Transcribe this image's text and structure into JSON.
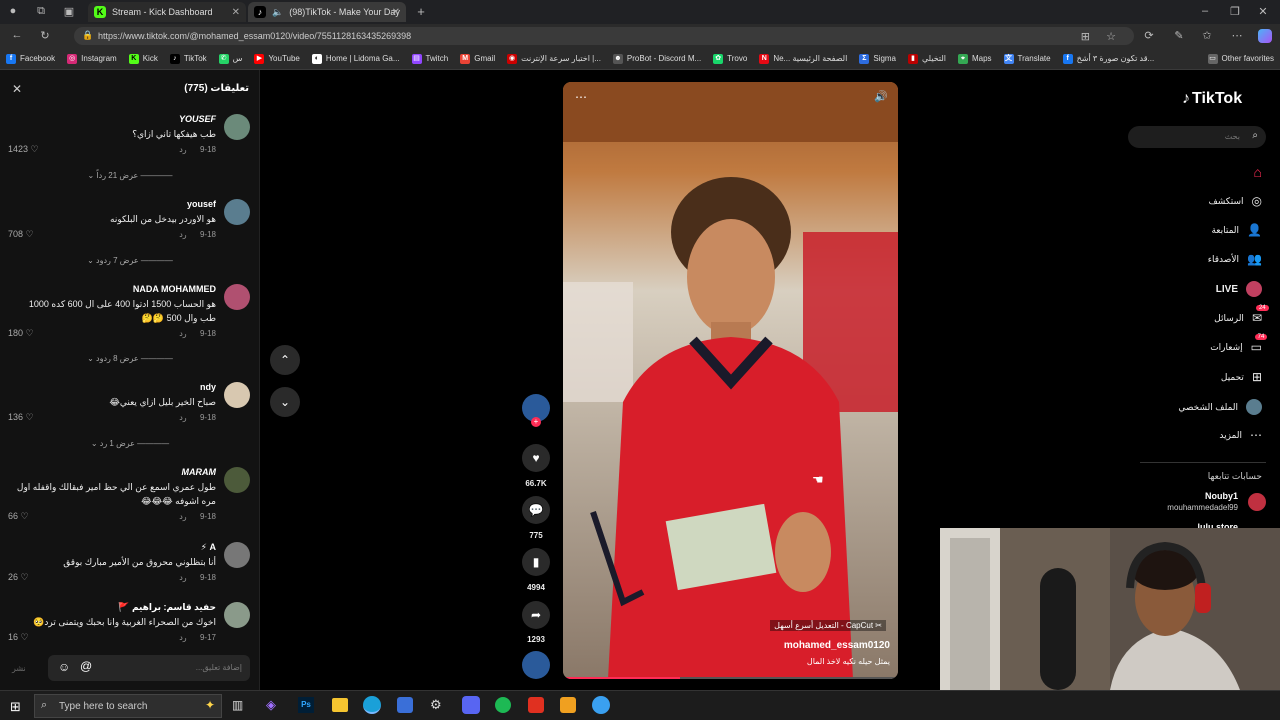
{
  "browser": {
    "tabs": [
      {
        "title": "Stream - Kick Dashboard",
        "active": false
      },
      {
        "title": "(98)TikTok - Make Your Day",
        "active": true
      }
    ],
    "url": "https://www.tiktok.com/@mohamed_essam0120/video/7551128163435269398",
    "bookmarks": [
      "Facebook",
      "Instagram",
      "Kick",
      "TikTok",
      "س",
      "YouTube",
      "Home | Lidoma Ga...",
      "Twitch",
      "Gmail",
      "اختبار سرعة الإنترنت |...",
      "ProBot - Discord M...",
      "Trovo",
      "Ne... الصفحة الرئيسية",
      "Sigma",
      "التخيلي",
      "Maps",
      "Translate",
      "قد تكون صورة ٣ أشخ..."
    ],
    "other_favorites": "Other favorites"
  },
  "comments": {
    "header": "تعليقات (775)",
    "items": [
      {
        "name": "YOUSEF",
        "text": "طب هيفكها تاني ازاي؟",
        "date": "9-18",
        "reply": "رد",
        "likes": "1423",
        "replies": "عرض 21 رداً",
        "avatar": "#6b8a7a"
      },
      {
        "name": "yousef",
        "text": "هو الاوردر بيدخل من البلكونه",
        "date": "9-18",
        "reply": "رد",
        "likes": "708",
        "replies": "عرض 7 ردود",
        "avatar": "#5a7d8f"
      },
      {
        "name": "NADA MOHAMMED",
        "text": "هو الحساب 1500 ادتوا 400 على ال 600 كده 1000 طب وال 500 🤔🤔",
        "date": "9-18",
        "reply": "رد",
        "likes": "180",
        "replies": "عرض 8 ردود",
        "avatar": "#b05070"
      },
      {
        "name": "ndy",
        "text": "صباح الخير بليل ازاي يعني😂",
        "date": "9-18",
        "reply": "رد",
        "likes": "136",
        "replies": "عرض 1 رد",
        "avatar": "#d8c8b0"
      },
      {
        "name": "MARAM",
        "text": "طول عمري اسمع عن الي حظ امير فبقالك واقفله اول مره اشوفه 😂😂😂",
        "date": "9-18",
        "reply": "رد",
        "likes": "66",
        "replies": "",
        "avatar": "#4c5a3a"
      },
      {
        "name": "A ⚡",
        "text": "أنا بتظلوني محروق من الأمير مبارك بوقق",
        "date": "9-18",
        "reply": "رد",
        "likes": "26",
        "replies": "",
        "avatar": "#777777"
      },
      {
        "name": "حفيد قاسم: براهيم 🚩",
        "text": "اخوك من الصحراء الغربية وانا بحبك ويتمنى ترد🥺",
        "date": "9-17",
        "reply": "رد",
        "likes": "16",
        "replies": "",
        "avatar": "#8a9a8a"
      }
    ],
    "input_placeholder": "إضافة تعليق...",
    "post_label": "نشر"
  },
  "video": {
    "capcut_text": "CapCut - التعديل أسرع أسهل",
    "username": "mohamed_essam0120",
    "caption": "يمثل حيله نكيه لاخذ المال"
  },
  "actions": {
    "likes": "66.7K",
    "comments": "775",
    "saves": "4994",
    "shares": "1293"
  },
  "tiktok_nav": {
    "logo": "TikTok",
    "search_placeholder": "بحث",
    "items": [
      {
        "label": "",
        "icon": "home-icon"
      },
      {
        "label": "استكشف",
        "icon": "compass-icon"
      },
      {
        "label": "المتابعة",
        "icon": "follow-icon"
      },
      {
        "label": "الأصدقاء",
        "icon": "friends-icon"
      },
      {
        "label": "LIVE",
        "icon": "live-icon"
      },
      {
        "label": "الرسائل",
        "icon": "message-icon",
        "badge": "24"
      },
      {
        "label": "إشعارات",
        "icon": "bell-icon",
        "badge": "74"
      },
      {
        "label": "تحميل",
        "icon": "upload-icon"
      },
      {
        "label": "الملف الشخصي",
        "icon": "profile-icon"
      },
      {
        "label": "المزيد",
        "icon": "more-icon"
      }
    ],
    "following_title": "حسابات تتابعها",
    "following": [
      {
        "name": "Nouby1",
        "handle": "mouhammedadel99"
      },
      {
        "name": "lulu store",
        "handle": ""
      }
    ]
  },
  "taskbar": {
    "search_placeholder": "Type here to search"
  }
}
